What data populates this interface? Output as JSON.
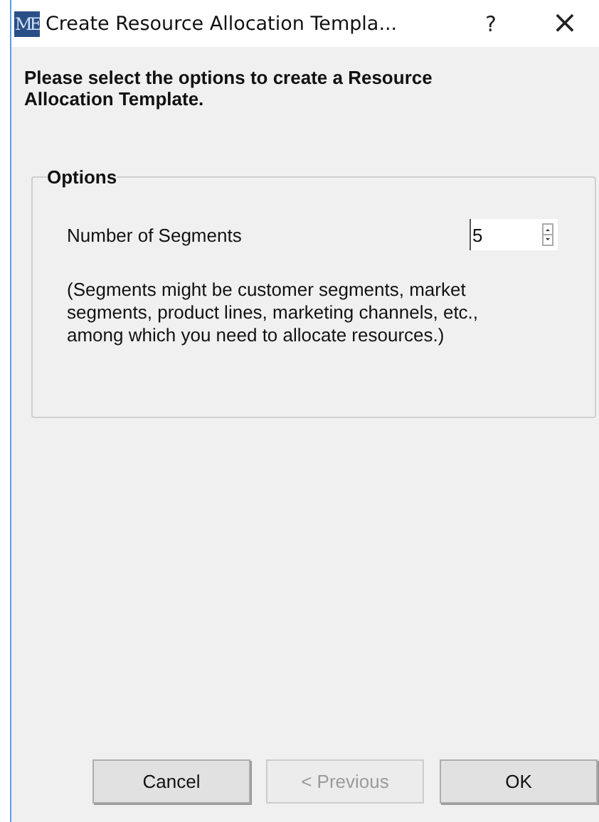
{
  "window": {
    "app_icon": "ME",
    "title": "Create Resource Allocation Templa...",
    "help": "?",
    "close": "×"
  },
  "intro": "Please select the options to create a Resource Allocation Template.",
  "options": {
    "legend": "Options",
    "segments_label": "Number of Segments",
    "segments_value": "5",
    "note": "(Segments might be customer segments, market segments, product lines, marketing channels, etc., among which you need to allocate resources.)"
  },
  "buttons": [
    {
      "label": "Cancel",
      "disabled": false
    },
    {
      "label": "< Previous",
      "disabled": true
    },
    {
      "label": "OK",
      "disabled": false
    }
  ]
}
